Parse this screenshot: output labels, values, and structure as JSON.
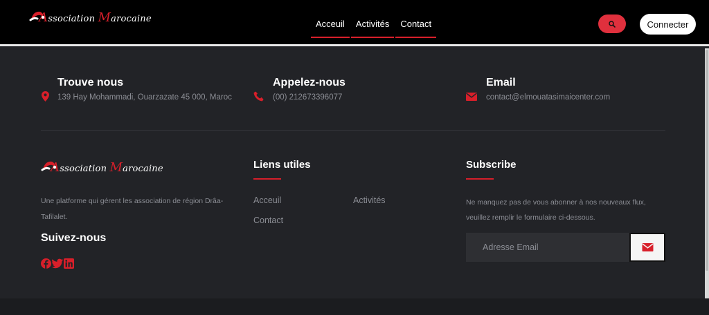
{
  "colors": {
    "accent": "#d81f2a",
    "background": "#222327",
    "navbar": "#000000"
  },
  "brand": {
    "first_cap": "A",
    "first_rest": "ssociation ",
    "second_cap": "M",
    "second_rest": "arocaine"
  },
  "nav": {
    "items": [
      "Acceuil",
      "Activités",
      "Contact"
    ],
    "search_icon": "search-icon",
    "connect_label": "Connecter"
  },
  "contact": {
    "address": {
      "title": "Trouve nous",
      "value": "139 Hay Mohammadi, Ouarzazate 45 000, Maroc",
      "icon": "map-marker-icon"
    },
    "phone": {
      "title": "Appelez-nous",
      "value": "(00) 212673396077",
      "icon": "phone-icon"
    },
    "email": {
      "title": "Email",
      "value": "contact@elmouatasimaicenter.com",
      "icon": "envelope-icon"
    }
  },
  "about": {
    "description": "Une platforme qui gérent les association de région Drâa-Tafilalet.",
    "follow_title": "Suivez-nous",
    "socials": [
      "facebook-icon",
      "twitter-icon",
      "linkedin-icon"
    ]
  },
  "useful_links": {
    "title": "Liens utiles",
    "items": [
      "Acceuil",
      "Activités",
      "Contact"
    ]
  },
  "subscribe": {
    "title": "Subscribe",
    "description": "Ne manquez pas de vous abonner à nos nouveaux flux, veuillez remplir le formulaire ci-dessous.",
    "placeholder": "Adresse Email",
    "send_icon": "envelope-icon"
  }
}
